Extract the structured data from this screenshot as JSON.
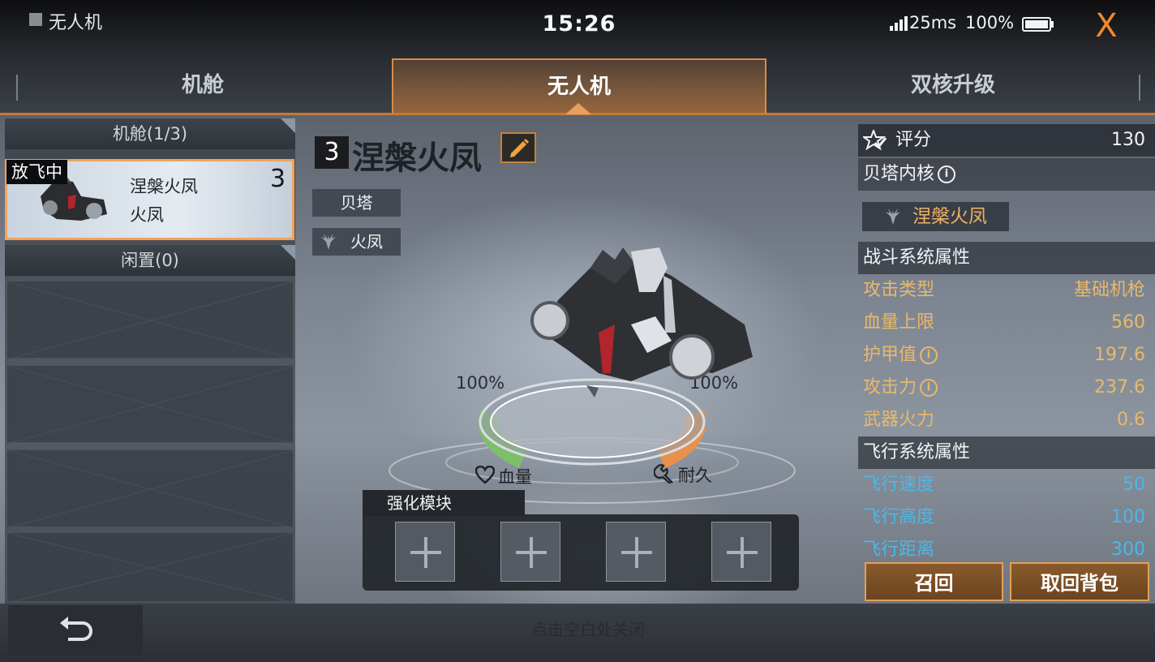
{
  "window": {
    "title": "无人机"
  },
  "status_bar": {
    "time": "15:26",
    "ping": "25ms",
    "battery": "100%",
    "close_label": "X"
  },
  "tabs": [
    {
      "label": "机舱",
      "active": false
    },
    {
      "label": "无人机",
      "active": true
    },
    {
      "label": "双核升级",
      "active": false
    }
  ],
  "left_panel": {
    "cabin_header": "机舱(1/3)",
    "idle_header": "闲置(0)",
    "card": {
      "badge": "放飞中",
      "name": "涅槃火凤",
      "subname": "火凤",
      "level": "3"
    }
  },
  "drone": {
    "level": "3",
    "name": "涅槃火凤",
    "tags": [
      "贝塔",
      "火凤"
    ],
    "hp_percent": "100%",
    "durability_percent": "100%",
    "hp_label": "血量",
    "durability_label": "耐久"
  },
  "modules": {
    "title": "强化模块",
    "slots": 4
  },
  "stats": {
    "score_label": "评分",
    "score_value": "130",
    "core_label": "贝塔内核",
    "core_name": "涅槃火凤",
    "combat_header": "战斗系统属性",
    "combat": [
      {
        "key": "攻击类型",
        "value": "基础机枪",
        "info": false
      },
      {
        "key": "血量上限",
        "value": "560",
        "info": false
      },
      {
        "key": "护甲值",
        "value": "197.6",
        "info": true
      },
      {
        "key": "攻击力",
        "value": "237.6",
        "info": true
      },
      {
        "key": "武器火力",
        "value": "0.6",
        "info": false
      }
    ],
    "flight_header": "飞行系统属性",
    "flight": [
      {
        "key": "飞行速度",
        "value": "50"
      },
      {
        "key": "飞行高度",
        "value": "100"
      },
      {
        "key": "飞行距离",
        "value": "300"
      }
    ]
  },
  "actions": {
    "recall": "召回",
    "retrieve": "取回背包"
  },
  "bottom": {
    "hint": "点击空白处关闭"
  },
  "colors": {
    "accent": "#e0a05a",
    "combat": "#e8b969",
    "flight": "#4bb8e8",
    "close": "#ef8a2c",
    "hp": "#7fbf6a",
    "durability": "#e9914a"
  }
}
